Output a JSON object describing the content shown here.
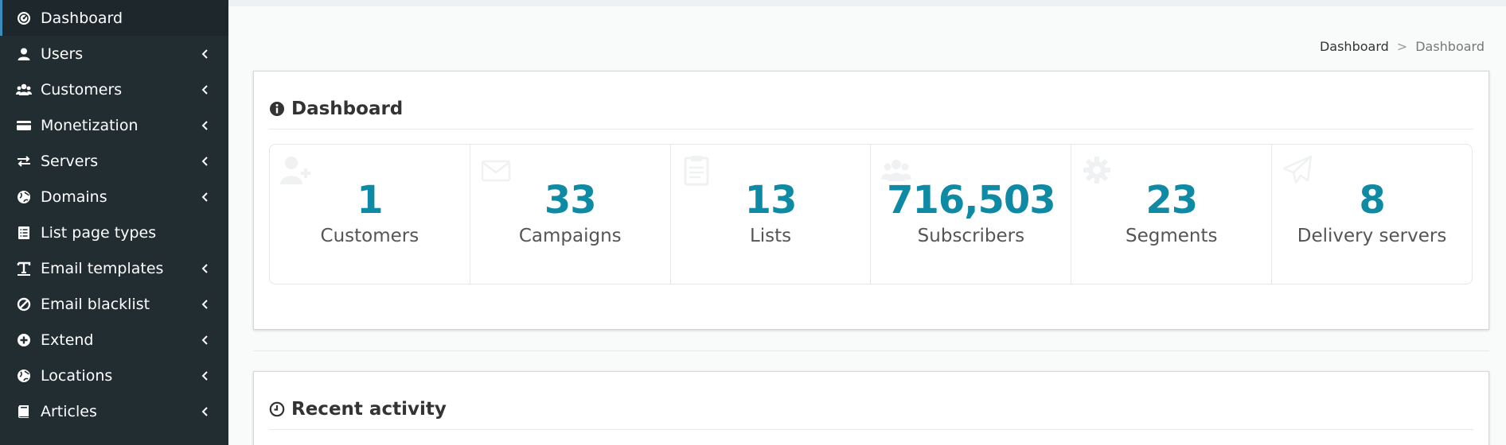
{
  "sidebar": {
    "items": [
      {
        "label": "Dashboard",
        "icon": "dashboard-icon",
        "active": true
      },
      {
        "label": "Users",
        "icon": "user-icon"
      },
      {
        "label": "Customers",
        "icon": "users-icon"
      },
      {
        "label": "Monetization",
        "icon": "credit-card-icon"
      },
      {
        "label": "Servers",
        "icon": "exchange-icon"
      },
      {
        "label": "Domains",
        "icon": "globe-icon"
      },
      {
        "label": "List page types",
        "icon": "list-icon"
      },
      {
        "label": "Email templates",
        "icon": "text-icon"
      },
      {
        "label": "Email blacklist",
        "icon": "ban-icon"
      },
      {
        "label": "Extend",
        "icon": "plus-circle-icon"
      },
      {
        "label": "Locations",
        "icon": "globe-icon"
      },
      {
        "label": "Articles",
        "icon": "book-icon"
      }
    ]
  },
  "breadcrumb": {
    "root": "Dashboard",
    "separator": ">",
    "current": "Dashboard"
  },
  "dashboard_box": {
    "title": "Dashboard",
    "icon": "info-circle-icon"
  },
  "stats": [
    {
      "count": "1",
      "label": "Customers",
      "icon": "user-plus-icon"
    },
    {
      "count": "33",
      "label": "Campaigns",
      "icon": "envelope-icon"
    },
    {
      "count": "13",
      "label": "Lists",
      "icon": "clipboard-icon"
    },
    {
      "count": "716,503",
      "label": "Subscribers",
      "icon": "users-icon"
    },
    {
      "count": "23",
      "label": "Segments",
      "icon": "gear-icon"
    },
    {
      "count": "8",
      "label": "Delivery servers",
      "icon": "paper-plane-icon"
    }
  ],
  "activity_box": {
    "title": "Recent activity",
    "icon": "clock-icon"
  },
  "colors": {
    "sidebar_bg": "#222d32",
    "accent": "#0e8aa5",
    "active_border": "#3c8dbc"
  }
}
